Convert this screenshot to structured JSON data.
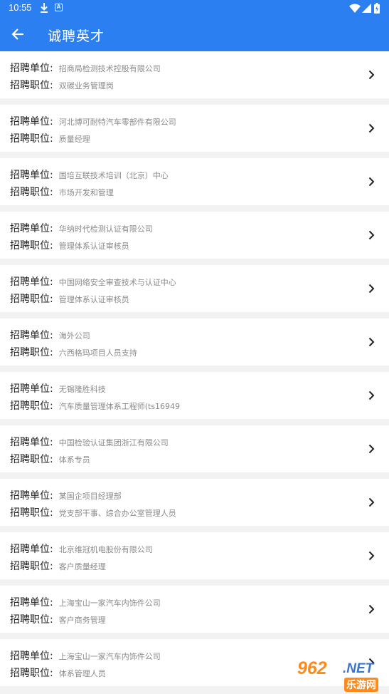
{
  "status_bar": {
    "time": "10:55",
    "icons": [
      "download-icon",
      "a-notification-icon",
      "wifi-icon",
      "signal-icon",
      "battery-icon"
    ]
  },
  "app_bar": {
    "title": "诚聘英才",
    "back_icon": "arrow-left-icon"
  },
  "labels": {
    "unit": "招聘单位:",
    "position": "招聘职位:"
  },
  "jobs": [
    {
      "unit": "招商局检测技术控股有限公司",
      "position": "双碳业务管理岗"
    },
    {
      "unit": "河北博可耐特汽车零部件有限公司",
      "position": "质量经理"
    },
    {
      "unit": "国培互联技术培训（北京）中心",
      "position": "市场开发和管理"
    },
    {
      "unit": "华纳时代检测认证有限公司",
      "position": "管理体系认证审核员"
    },
    {
      "unit": "中国网络安全审查技术与认证中心",
      "position": "管理体系认证审核员"
    },
    {
      "unit": "海外公司",
      "position": "六西格玛项目人员支持"
    },
    {
      "unit": "无锡隆胜科技",
      "position": "汽车质量管理体系工程师(ts16949"
    },
    {
      "unit": "中国检验认证集团浙江有限公司",
      "position": "体系专员"
    },
    {
      "unit": "某国企项目经理部",
      "position": "党支部干事、综合办公室管理人员"
    },
    {
      "unit": "北京维冠机电股份有限公司",
      "position": "客户质量经理"
    },
    {
      "unit": "上海宝山一家汽车内饰件公司",
      "position": "客户商务管理"
    },
    {
      "unit": "上海宝山一家汽车内饰件公司",
      "position": "体系管理人员"
    }
  ],
  "watermark": {
    "number": "962",
    "domain": ".NET",
    "text": "乐游网"
  },
  "colors": {
    "primary": "#2c7ff0",
    "background": "#f2f2f2",
    "value_text": "#8a8a8a"
  }
}
